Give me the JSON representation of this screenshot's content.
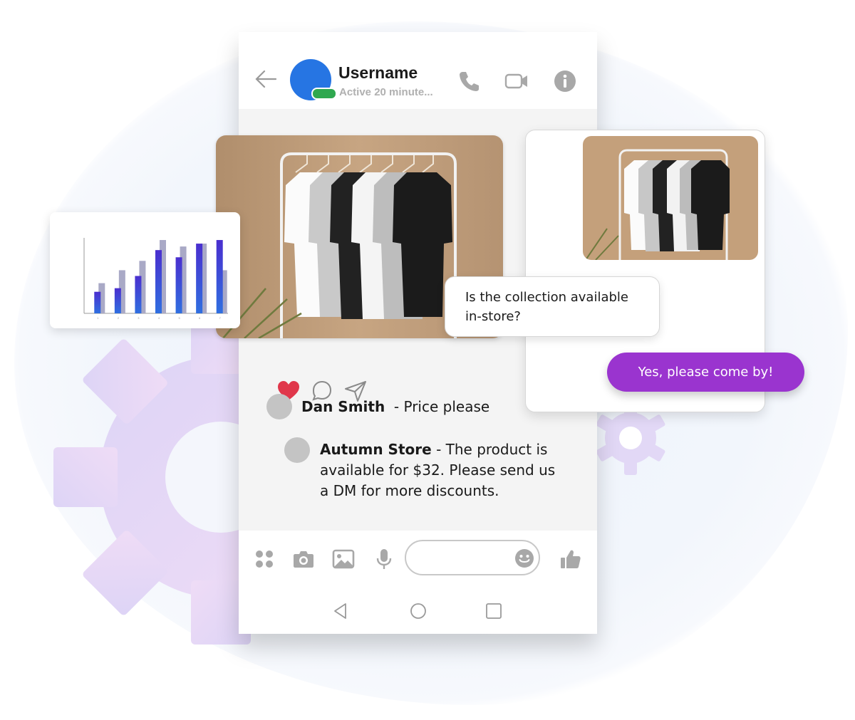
{
  "header": {
    "username": "Username",
    "status": "Active 20 minute..."
  },
  "icons": {
    "back": "back-arrow-icon",
    "call": "phone-icon",
    "video": "video-camera-icon",
    "info": "info-icon",
    "like": "heart-icon",
    "comment": "comment-bubble-icon",
    "share": "send-icon",
    "apps": "apps-grid-icon",
    "camera": "camera-icon",
    "gallery": "image-icon",
    "mic": "microphone-icon",
    "emoji": "smiley-icon",
    "thumbs_up": "thumbs-up-icon"
  },
  "post": {
    "liked": true
  },
  "comments": [
    {
      "author": "Dan Smith",
      "text": "- Price please"
    },
    {
      "author": "Autumn Store",
      "text_lines": [
        "- The product is",
        "available for $32. Please send us",
        "a DM for more discounts."
      ]
    }
  ],
  "dm": {
    "incoming": "Is the collection available in-store?",
    "outgoing": "Yes, please come by!"
  },
  "colors": {
    "avatar": "#2675e3",
    "online": "#2fa84f",
    "outgoing_bubble": "#9a34cf",
    "heart": "#e0374b",
    "bar_front": "#2f6fe0",
    "bar_front_top": "#4a2fcf",
    "bar_back": "#a9a9c6"
  },
  "chart_data": {
    "type": "bar",
    "categories": [
      "1",
      "2",
      "3",
      "4",
      "5",
      "6",
      "7"
    ],
    "series": [
      {
        "values": [
          30,
          35,
          52,
          88,
          78,
          97,
          102
        ]
      },
      {
        "values": [
          42,
          60,
          73,
          102,
          93,
          97,
          60
        ]
      }
    ],
    "ylim": [
      0,
      105
    ]
  }
}
